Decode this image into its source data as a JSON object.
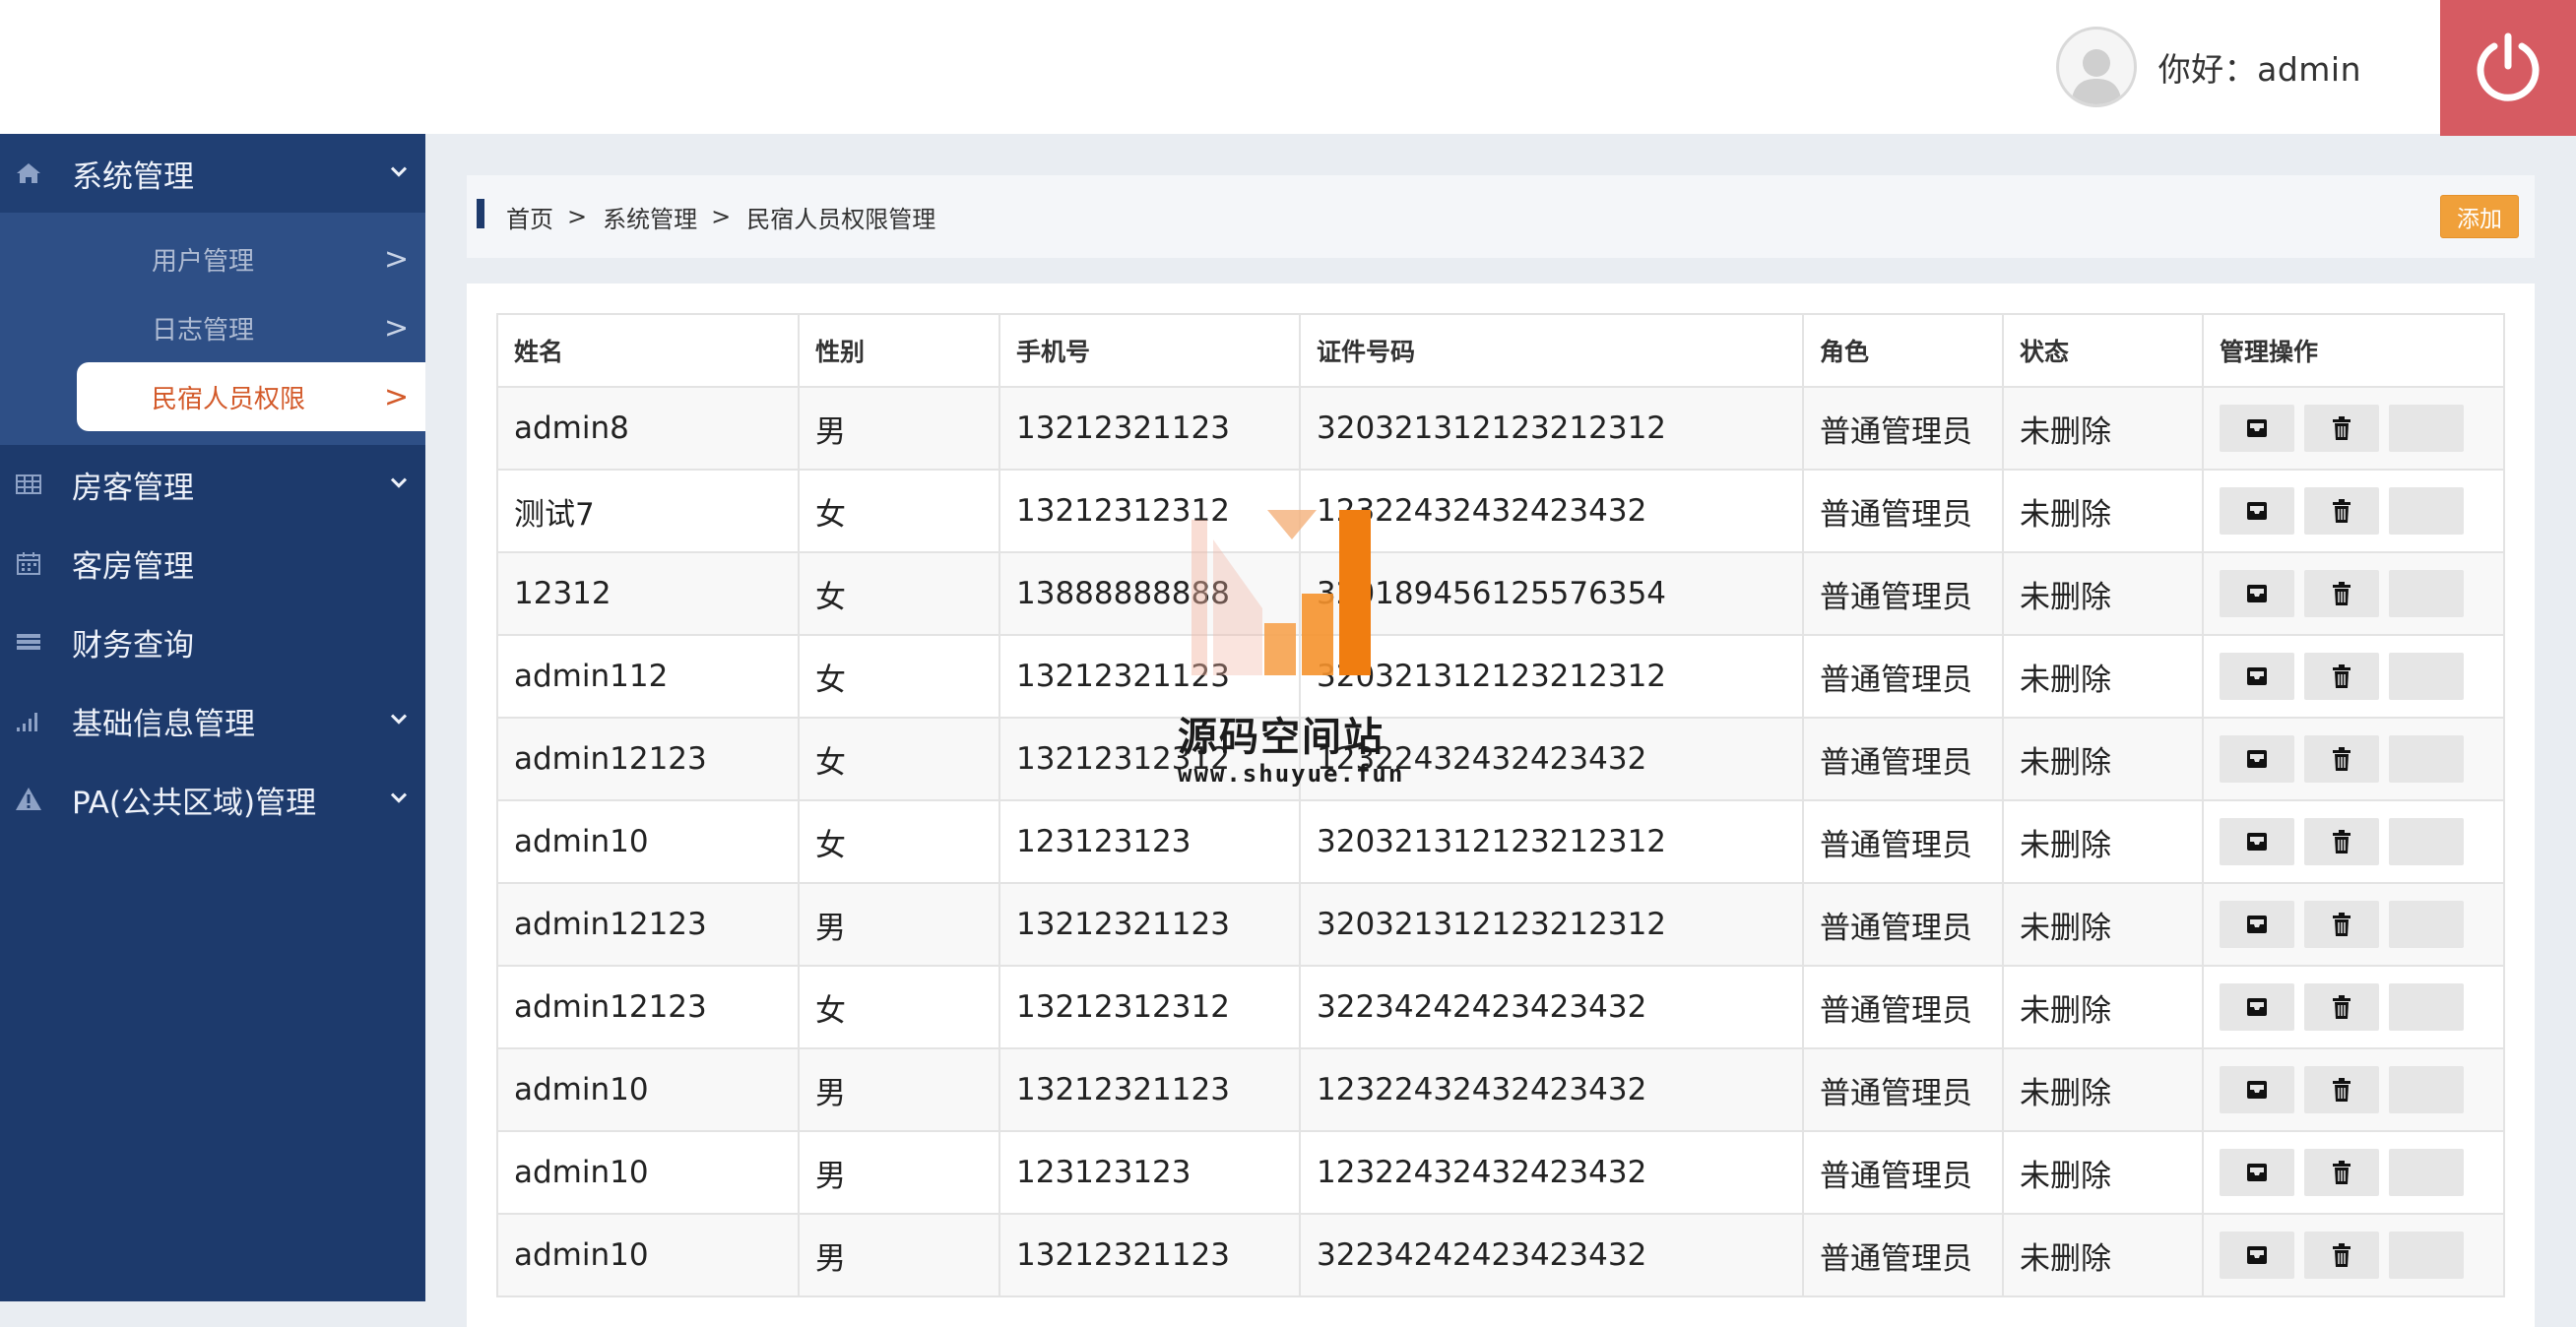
{
  "header": {
    "greeting": "你好：admin"
  },
  "sidebar": {
    "groups": [
      {
        "label": "系统管理",
        "icon": "home-icon",
        "expanded": true
      },
      {
        "label": "房客管理",
        "icon": "grid-icon"
      },
      {
        "label": "客房管理",
        "icon": "calendar-icon"
      },
      {
        "label": "财务查询",
        "icon": "list-icon"
      },
      {
        "label": "基础信息管理",
        "icon": "signal-icon"
      },
      {
        "label": "PA(公共区域)管理",
        "icon": "warning-icon"
      }
    ],
    "sub_items": [
      {
        "label": "用户管理",
        "arrow": ">"
      },
      {
        "label": "日志管理",
        "arrow": ">"
      },
      {
        "label": "民宿人员权限",
        "arrow": ">",
        "active": true
      }
    ]
  },
  "breadcrumb": {
    "items": [
      "首页",
      "系统管理",
      "民宿人员权限管理"
    ],
    "separator": ">"
  },
  "add_button": "添加",
  "table": {
    "columns": [
      "姓名",
      "性别",
      "手机号",
      "证件号码",
      "角色",
      "状态",
      "管理操作"
    ],
    "rows": [
      [
        "admin8",
        "男",
        "13212321123",
        "320321312123212312",
        "普通管理员",
        "未删除"
      ],
      [
        "测试7",
        "女",
        "13212312312",
        "12322432432423432",
        "普通管理员",
        "未删除"
      ],
      [
        "12312",
        "女",
        "13888888888",
        "320189456125576354",
        "普通管理员",
        "未删除"
      ],
      [
        "admin112",
        "女",
        "13212321123",
        "320321312123212312",
        "普通管理员",
        "未删除"
      ],
      [
        "admin12123",
        "女",
        "13212312312",
        "12322432432423432",
        "普通管理员",
        "未删除"
      ],
      [
        "admin10",
        "女",
        "123123123",
        "320321312123212312",
        "普通管理员",
        "未删除"
      ],
      [
        "admin12123",
        "男",
        "13212321123",
        "320321312123212312",
        "普通管理员",
        "未删除"
      ],
      [
        "admin12123",
        "女",
        "13212312312",
        "32234242423423432",
        "普通管理员",
        "未删除"
      ],
      [
        "admin10",
        "男",
        "13212321123",
        "12322432432423432",
        "普通管理员",
        "未删除"
      ],
      [
        "admin10",
        "男",
        "123123123",
        "12322432432423432",
        "普通管理员",
        "未删除"
      ],
      [
        "admin10",
        "男",
        "13212321123",
        "32234242423423432",
        "普通管理员",
        "未删除"
      ]
    ],
    "row_actions": [
      "inbox-icon",
      "trash-icon",
      "blank-button"
    ]
  },
  "watermark": {
    "title": "源码空间站",
    "url": "www.shuyue.fun"
  },
  "colors": {
    "sidebar": "#1d3a6c",
    "submenu": "#2e4f86",
    "active_text": "#d35a2a",
    "logout": "#d65b62",
    "add_button": "#f0a03a"
  }
}
